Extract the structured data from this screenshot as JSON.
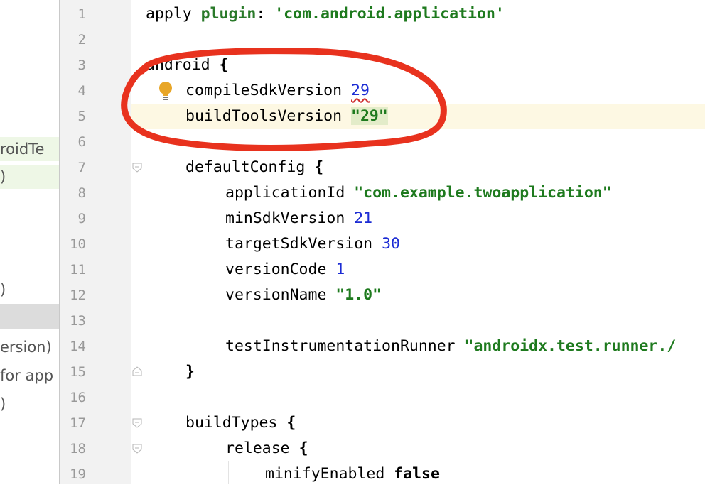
{
  "left_panel": {
    "fragments": [
      "roidTe",
      ")",
      ")",
      "ersion)",
      "for app",
      ")"
    ]
  },
  "gutter": {
    "line_numbers": [
      "1",
      "2",
      "3",
      "4",
      "5",
      "6",
      "7",
      "8",
      "9",
      "10",
      "11",
      "12",
      "13",
      "14",
      "15",
      "16",
      "17",
      "18",
      "19"
    ]
  },
  "code": {
    "l1": {
      "a": "apply ",
      "b": "plugin",
      "c": ": ",
      "d": "'com.android.application'"
    },
    "l3": {
      "a": "android ",
      "b": "{"
    },
    "l4": {
      "a": "compileSdkVersion ",
      "b": "29"
    },
    "l5": {
      "a": "buildToolsVersion ",
      "b": "\"29\""
    },
    "l7": {
      "a": "defaultConfig ",
      "b": "{"
    },
    "l8": {
      "a": "applicationId ",
      "b": "\"com.example.twoapplication\""
    },
    "l9": {
      "a": "minSdkVersion ",
      "b": "21"
    },
    "l10": {
      "a": "targetSdkVersion ",
      "b": "30"
    },
    "l11": {
      "a": "versionCode ",
      "b": "1"
    },
    "l12": {
      "a": "versionName ",
      "b": "\"1.0\""
    },
    "l14": {
      "a": "testInstrumentationRunner ",
      "b": "\"androidx.test.runner./"
    },
    "l15": {
      "a": "}"
    },
    "l17": {
      "a": "buildTypes ",
      "b": "{"
    },
    "l18": {
      "a": "release ",
      "b": "{"
    },
    "l19": {
      "a": "minifyEnabled ",
      "b": "false"
    }
  },
  "colors": {
    "annotation": "#e8321e",
    "bulb": "#e8a628",
    "current_line": "#fdf8e3"
  },
  "icons": [
    "lightbulb-icon",
    "fold-marker-icon"
  ]
}
